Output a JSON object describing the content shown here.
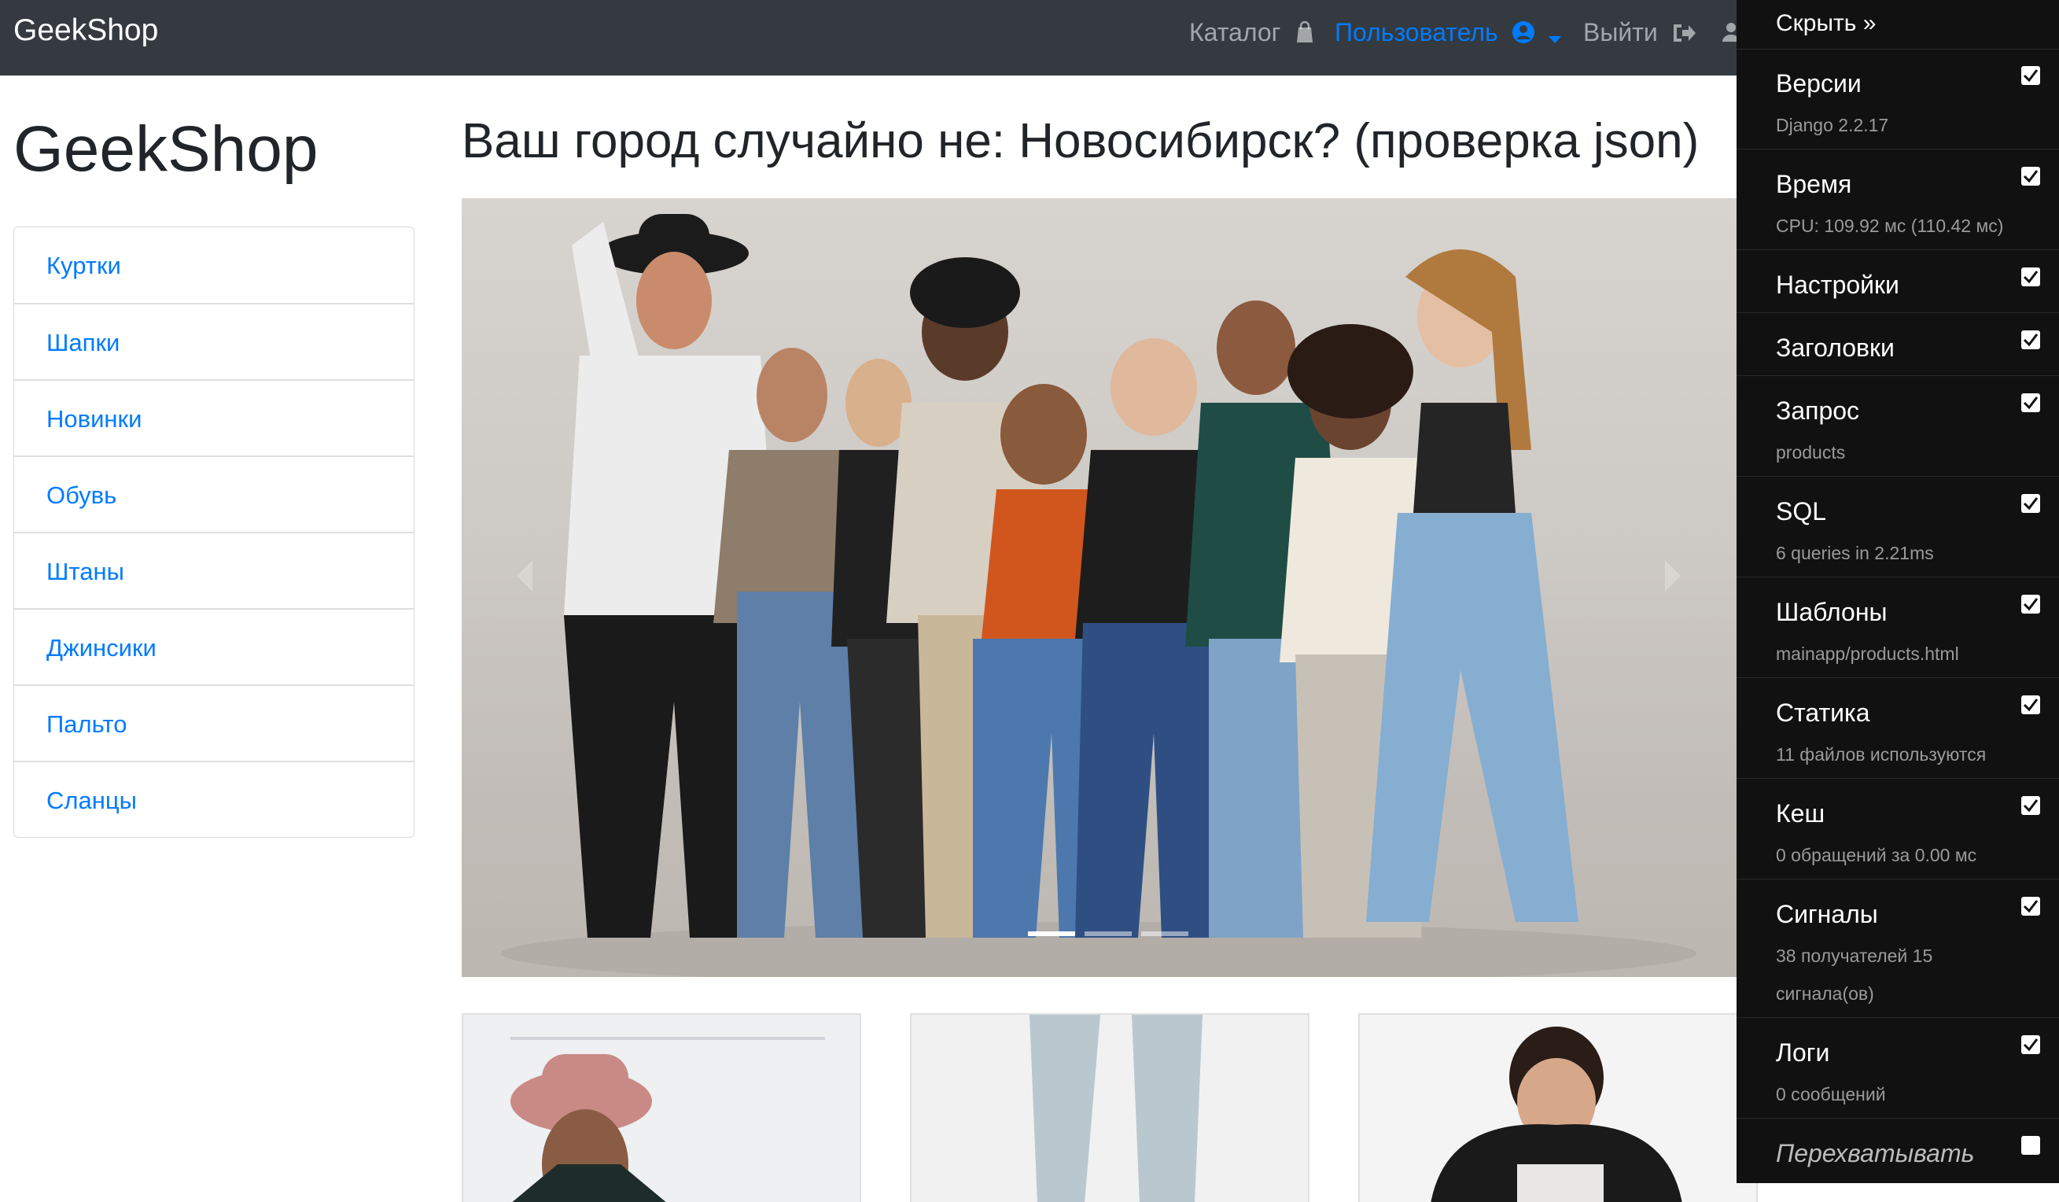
{
  "navbar": {
    "brand": "GeekShop",
    "catalog": "Каталог",
    "user": "Пользователь",
    "logout": "Выйти"
  },
  "sidebar": {
    "title": "GeekShop",
    "categories": [
      "Куртки",
      "Шапки",
      "Новинки",
      "Обувь",
      "Штаны",
      "Джинсики",
      "Пальто",
      "Сланцы"
    ]
  },
  "main": {
    "title": "Ваш город случайно не: Новосибирск? (проверка json)",
    "carousel": {
      "slides": 3,
      "active": 0
    }
  },
  "colors": {
    "navbar": "#343a40",
    "link": "#007bff",
    "toolbar": "#111111"
  },
  "debug_toolbar": {
    "hide": "Скрыть »",
    "panels": [
      {
        "title": "Версии",
        "sub": "Django 2.2.17",
        "checked": true
      },
      {
        "title": "Время",
        "sub": "CPU: 109.92 мс (110.42 мс)",
        "checked": true
      },
      {
        "title": "Настройки",
        "sub": "",
        "checked": true
      },
      {
        "title": "Заголовки",
        "sub": "",
        "checked": true
      },
      {
        "title": "Запрос",
        "sub": "products",
        "checked": true
      },
      {
        "title": "SQL",
        "sub": "6 queries in 2.21ms",
        "checked": true
      },
      {
        "title": "Шаблоны",
        "sub": "mainapp/products.html",
        "checked": true
      },
      {
        "title": "Статика",
        "sub": "11 файлов используются",
        "checked": true
      },
      {
        "title": "Кеш",
        "sub": "0 обращений за 0.00 мс",
        "checked": true
      },
      {
        "title": "Сигналы",
        "sub": "38 получателей 15 сигнала(ов)",
        "checked": true
      },
      {
        "title": "Логи",
        "sub": "0 сообщений",
        "checked": true
      },
      {
        "title": "Перехватывать",
        "sub": "",
        "checked": false
      }
    ]
  }
}
